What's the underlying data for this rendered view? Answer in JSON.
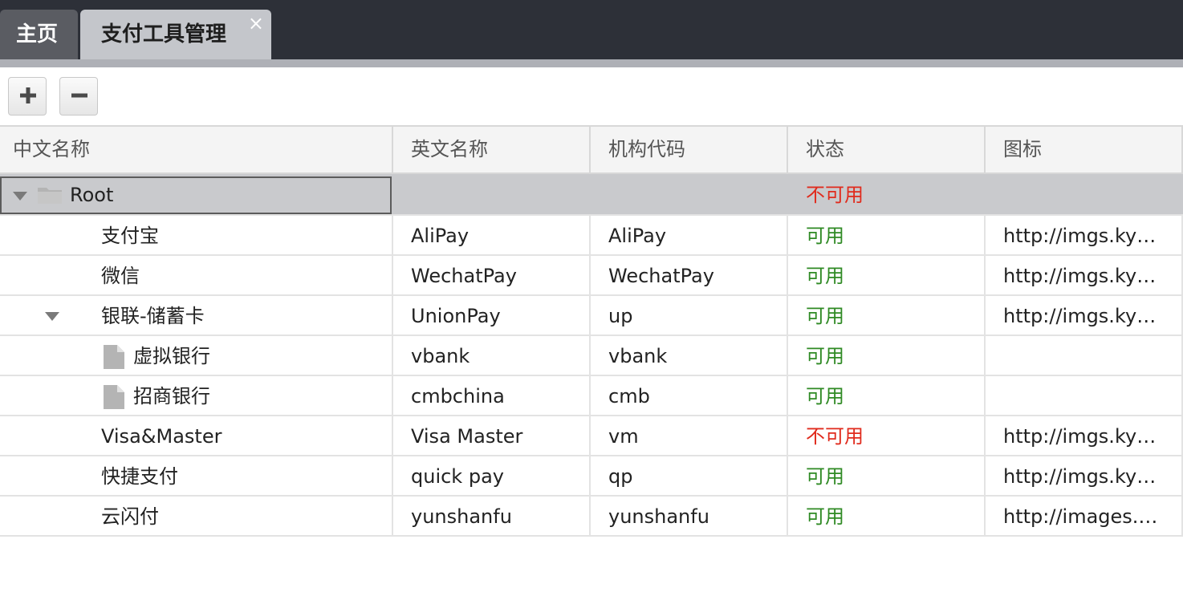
{
  "tabs": {
    "home_label": "主页",
    "active_label": "支付工具管理",
    "close_glyph": "×"
  },
  "toolbar": {
    "add_icon": "plus-icon",
    "remove_icon": "minus-icon"
  },
  "grid": {
    "columns": [
      "中文名称",
      "英文名称",
      "机构代码",
      "状态",
      "图标"
    ],
    "root": {
      "name": "Root",
      "status": "不可用",
      "icon": "folder-icon"
    },
    "rows": [
      {
        "name": "支付宝",
        "en": "AliPay",
        "code": "AliPay",
        "status": "可用",
        "icon_url": "http://imgs.kya…"
      },
      {
        "name": "微信",
        "en": "WechatPay",
        "code": "WechatPay",
        "status": "可用",
        "icon_url": "http://imgs.kya…"
      },
      {
        "name": "银联-储蓄卡",
        "en": "UnionPay",
        "code": "up",
        "status": "可用",
        "icon_url": "http://imgs.kya…"
      },
      {
        "name": "虚拟银行",
        "en": "vbank",
        "code": "vbank",
        "status": "可用",
        "icon_url": ""
      },
      {
        "name": "招商银行",
        "en": "cmbchina",
        "code": "cmb",
        "status": "可用",
        "icon_url": ""
      },
      {
        "name": "Visa&Master",
        "en": "Visa Master",
        "code": "vm",
        "status": "不可用",
        "icon_url": "http://imgs.kya…"
      },
      {
        "name": "快捷支付",
        "en": "quick pay",
        "code": "qp",
        "status": "可用",
        "icon_url": "http://imgs.kya…"
      },
      {
        "name": "云闪付",
        "en": "yunshanfu",
        "code": "yunshanfu",
        "status": "可用",
        "icon_url": "http://images.k…"
      }
    ]
  },
  "colors": {
    "available": "#2f8a24",
    "unavailable": "#e02b1d",
    "tabbar_bg": "#2d3038",
    "root_row_bg": "#c9cacd"
  }
}
